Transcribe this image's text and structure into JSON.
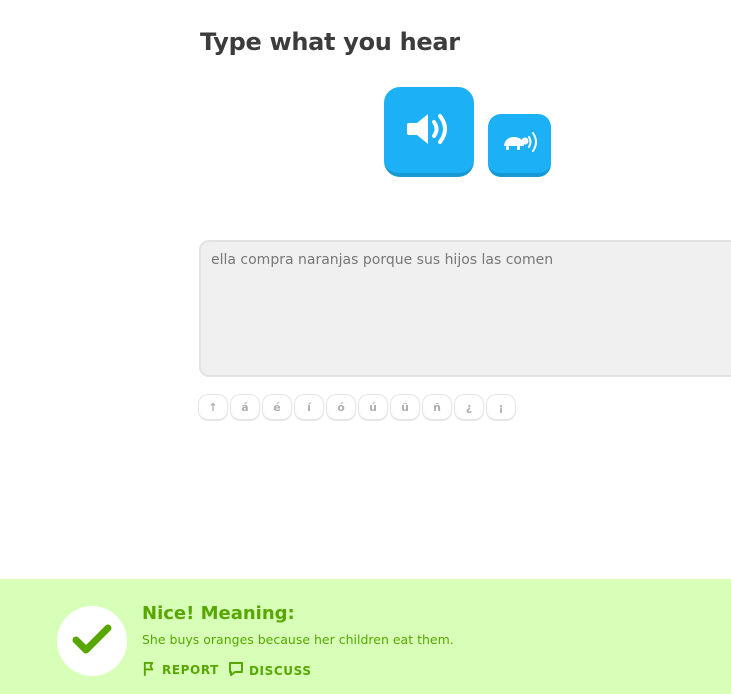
{
  "challenge": {
    "title": "Type what you hear"
  },
  "audio": {
    "play_icon": "speaker-icon",
    "slow_icon": "turtle-speaker-icon",
    "accent_color": "#1cb0f6"
  },
  "answer": {
    "value": "ella compra naranjas porque sus hijos las comen"
  },
  "keyboard": {
    "keys": [
      "↑",
      "á",
      "é",
      "í",
      "ó",
      "ú",
      "ü",
      "ñ",
      "¿",
      "¡"
    ]
  },
  "feedback": {
    "title": "Nice! Meaning:",
    "meaning": "She buys oranges because her children eat them.",
    "report_label": "REPORT",
    "discuss_label": "DISCUSS",
    "background_color": "#d7ffb8",
    "text_color": "#58a700"
  }
}
